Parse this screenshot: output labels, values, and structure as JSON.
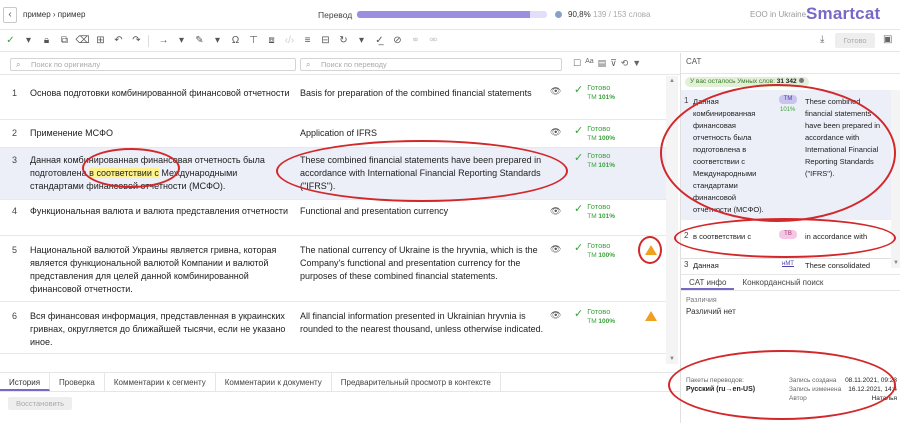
{
  "header": {
    "breadcrumb": "пример › пример",
    "progress_label": "Перевод",
    "progress_percent": "90,8%",
    "progress_fraction": 0.908,
    "progress_words": "139 / 153 слова",
    "org_name": "ЕОО in Ukraine",
    "brand": "Smartcat"
  },
  "toolbar": {
    "confirm_label": "Готово"
  },
  "search": {
    "source_placeholder": "Поиск по оригиналу",
    "target_placeholder": "Поиск по переводу",
    "case_label": "Aa"
  },
  "segments": [
    {
      "num": "1",
      "source": "Основа подготовки комбинированной финансовой отчетности",
      "target": "Basis for preparation of the combined financial statements",
      "status": "Готово",
      "tm": "TM",
      "match": "101%",
      "warning": false
    },
    {
      "num": "2",
      "source": "Применение МСФО",
      "target": "Application of IFRS",
      "status": "Готово",
      "tm": "TM",
      "match": "100%",
      "warning": false
    },
    {
      "num": "3",
      "source_before": "Данная комбинированная финансовая отчетность была подготовлена ",
      "source_highlight": "в соответствии с",
      "source_after": " Международными стандартами финансовой отчетности (МСФО).",
      "target": "These combined financial statements have been prepared in accordance with International Financial Reporting Standards (\"IFRS\").",
      "status": "Готово",
      "tm": "TM",
      "match": "101%",
      "warning": false
    },
    {
      "num": "4",
      "source": "Функциональная валюта и валюта представления отчетности",
      "target": "Functional and presentation currency",
      "status": "Готово",
      "tm": "TM",
      "match": "101%",
      "warning": false
    },
    {
      "num": "5",
      "source": "Национальной валютой Украины является гривна, которая является функциональной валютой Компании и валютой представления для целей данной комбинированной финансовой отчетности.",
      "target": "The national currency of Ukraine is the hryvnia, which is the Company's functional and presentation currency for the purposes of these combined financial statements.",
      "status": "Готово",
      "tm": "TM",
      "match": "100%",
      "warning": true
    },
    {
      "num": "6",
      "source": "Вся финансовая информация, представленная в украинских гривнах, округляется до ближайшей тысячи, если не указано иное.",
      "target": "All financial information presented in Ukrainian hryvnia is rounded to the nearest thousand, unless otherwise indicated.",
      "status": "Готово",
      "tm": "TM",
      "match": "100%",
      "warning": true
    }
  ],
  "bottom_tabs": [
    "История",
    "Проверка",
    "Комментарии к сегменту",
    "Комментарии к документу",
    "Предварительный просмотр в контексте"
  ],
  "restore_label": "Восстановить",
  "cat": {
    "tab": "CAT",
    "badge_prefix": "У вас осталось Умных слов:",
    "badge_count": "31 342",
    "items": [
      {
        "num": "1",
        "source": "Данная комбинированная финансовая отчетность была подготовлена в соответствии с Международными стандартами финансовой отчетности (МСФО).",
        "tm": "TM",
        "match": "101%",
        "target": "These combined financial statements have been prepared in accordance with International Financial Reporting Standards (\"IFRS\")."
      },
      {
        "num": "2",
        "source": "в соответствии с",
        "tm": "TB",
        "target": "in accordance with"
      },
      {
        "num": "3",
        "source": "Данная",
        "tm": "нМТ",
        "target": "These consolidated"
      }
    ],
    "info_tabs": [
      "CAT инфо",
      "Конкордансный поиск"
    ],
    "diff_label": "Различия",
    "diff_value": "Различий нет",
    "meta": {
      "pair_label": "Пакеты переводов:",
      "pair_value": "Русский (ru→en-US)",
      "created_label": "Запись создана",
      "created_value": "08.11.2021, 09:23",
      "changed_label": "Запись изменена",
      "changed_value": "16.12.2021, 14:4",
      "author_label": "Автор",
      "author_value": "Наталья"
    }
  }
}
